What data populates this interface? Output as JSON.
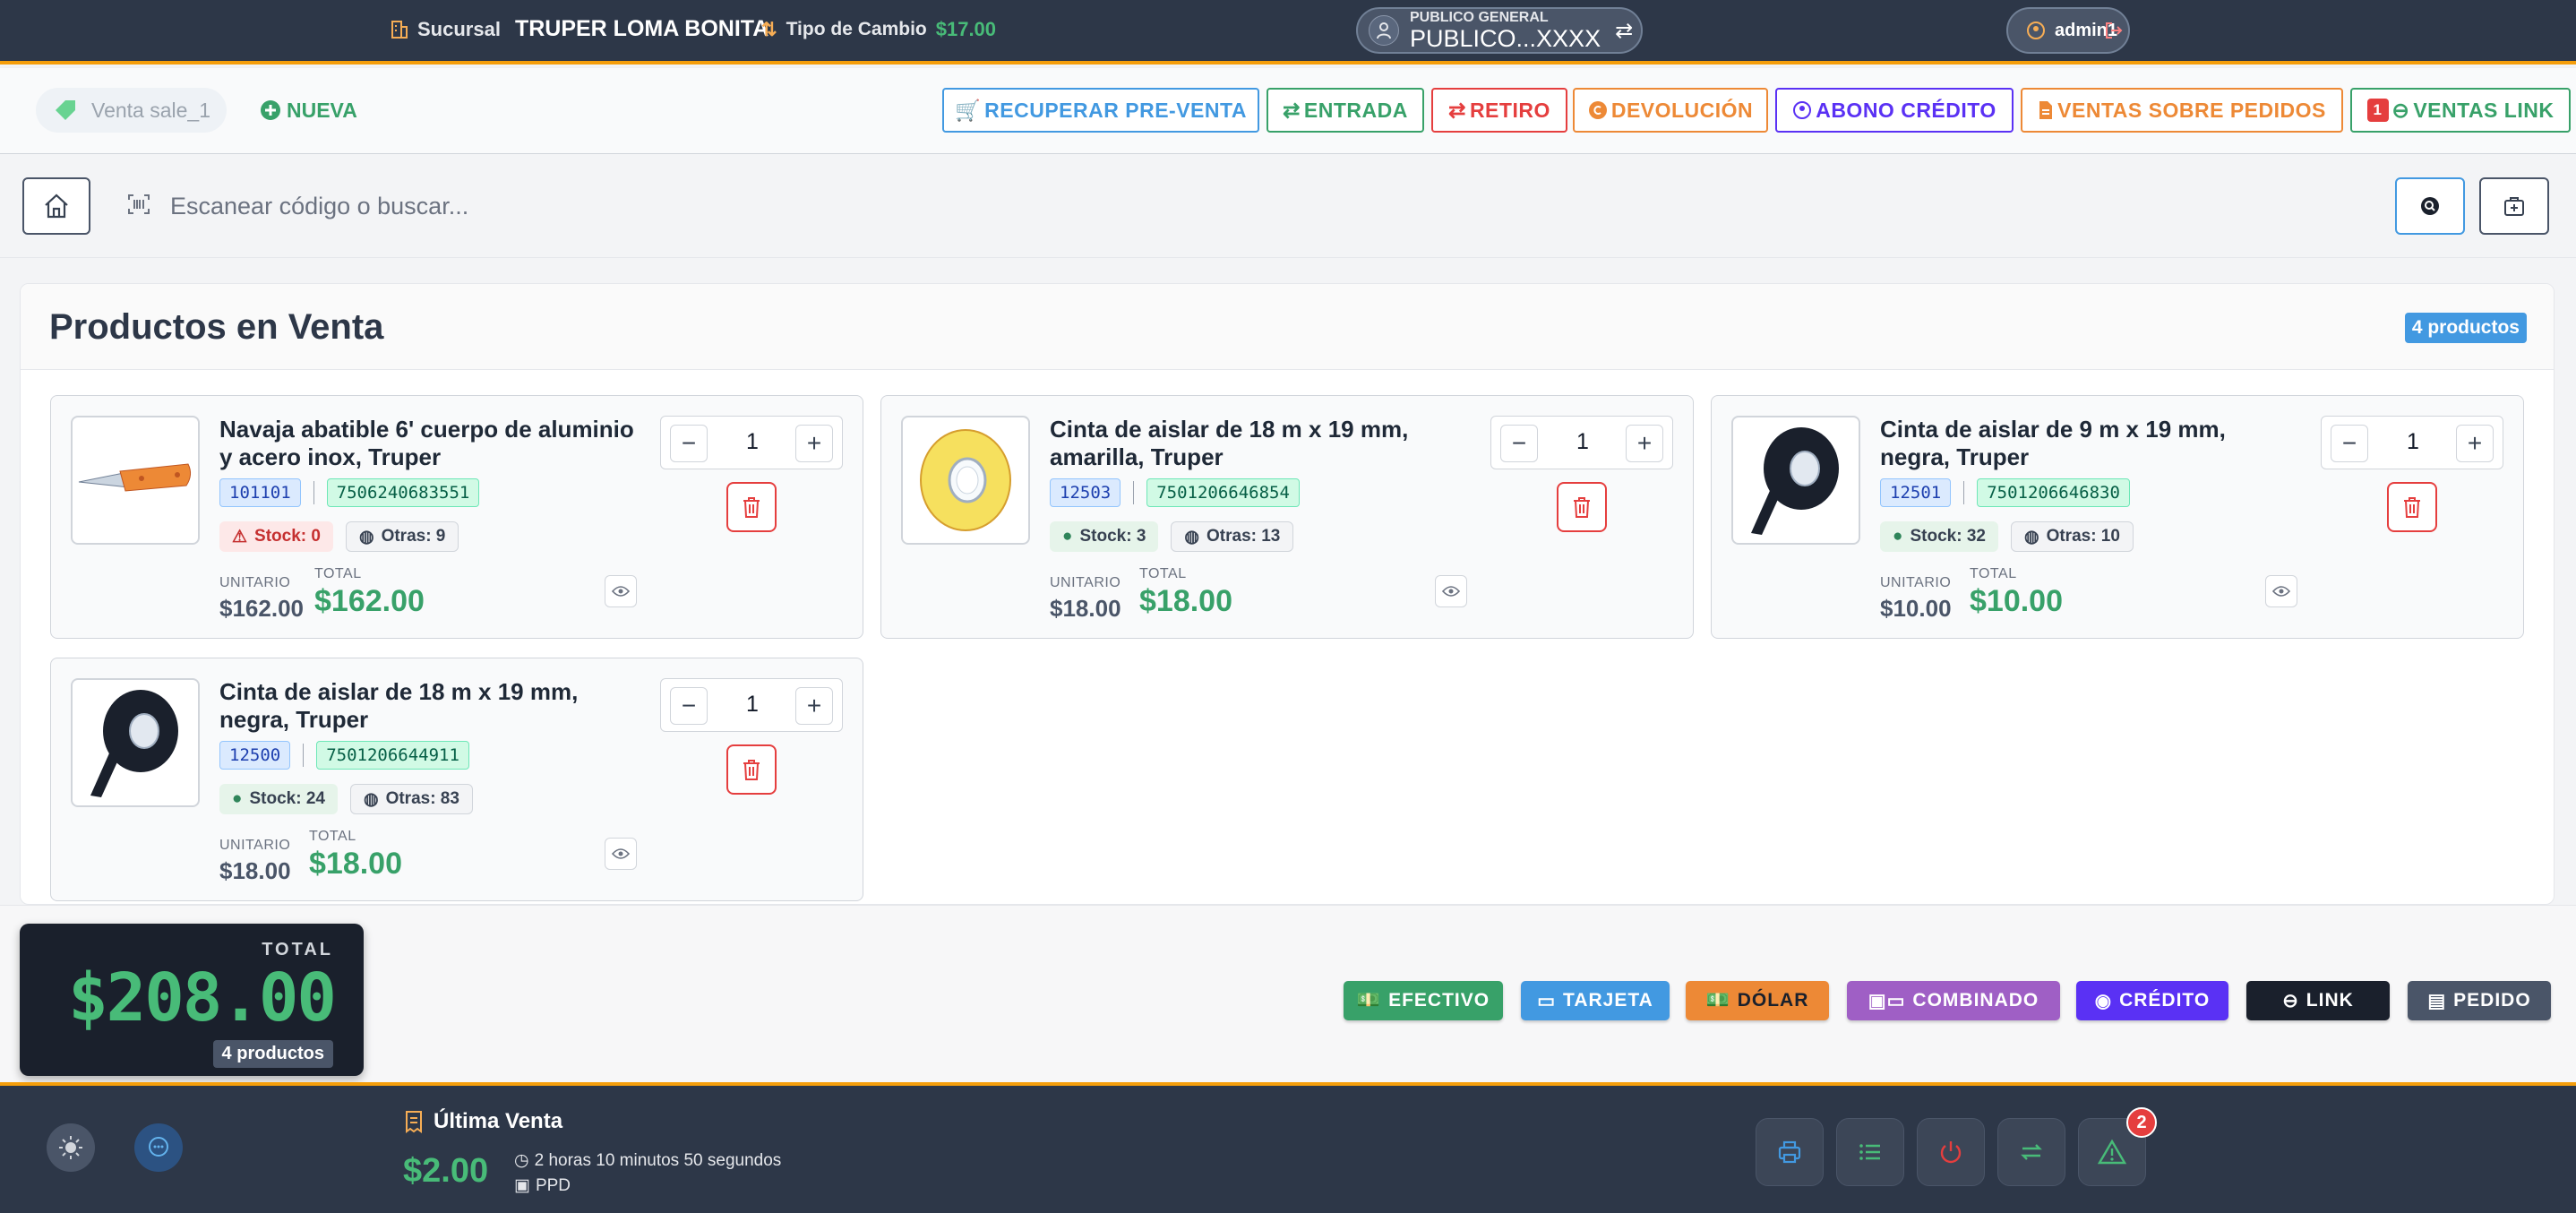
{
  "header": {
    "branch_label": "Sucursal",
    "branch_name": "TRUPER LOMA BONITA",
    "rate_label": "Tipo de Cambio",
    "rate_value": "$17.00",
    "client_type": "PUBLICO GENERAL",
    "client_name": "PUBLICO...XXXX",
    "user": "admin1"
  },
  "toolbar": {
    "sale_tab": "Venta sale_1",
    "new_label": "NUEVA",
    "actions": [
      {
        "label": "RECUPERAR PRE-VENTA",
        "color": "#4299e1"
      },
      {
        "label": "ENTRADA",
        "color": "#38a169"
      },
      {
        "label": "RETIRO",
        "color": "#e53e3e"
      },
      {
        "label": "DEVOLUCIÓN",
        "color": "#ed8936"
      },
      {
        "label": "ABONO CRÉDITO",
        "color": "#5a31f4"
      },
      {
        "label": "VENTAS SOBRE PEDIDOS",
        "color": "#ed8936"
      },
      {
        "label": "VENTAS LINK",
        "color": "#38a169",
        "badge": "1"
      }
    ]
  },
  "search": {
    "placeholder": "Escanear código o buscar..."
  },
  "products_panel": {
    "title": "Productos en Venta",
    "count_badge": "4 productos",
    "unit_label": "UNITARIO",
    "total_label": "TOTAL",
    "items": [
      {
        "name": "Navaja abatible 6' cuerpo de aluminio y acero inox, Truper",
        "sku": "101101",
        "barcode": "7506240683551",
        "stock": "Stock: 0",
        "stock_ok": false,
        "others": "Otras: 9",
        "unit": "$162.00",
        "total": "$162.00",
        "qty": "1",
        "thumb": "knife"
      },
      {
        "name": "Cinta de aislar de 18 m x 19 mm, amarilla, Truper",
        "sku": "12503",
        "barcode": "7501206646854",
        "stock": "Stock: 3",
        "stock_ok": true,
        "others": "Otras: 13",
        "unit": "$18.00",
        "total": "$18.00",
        "qty": "1",
        "thumb": "tape-yellow"
      },
      {
        "name": "Cinta de aislar de 9 m x 19 mm, negra, Truper",
        "sku": "12501",
        "barcode": "7501206646830",
        "stock": "Stock: 32",
        "stock_ok": true,
        "others": "Otras: 10",
        "unit": "$10.00",
        "total": "$10.00",
        "qty": "1",
        "thumb": "tape-black"
      },
      {
        "name": "Cinta de aislar de 18 m x 19 mm, negra, Truper",
        "sku": "12500",
        "barcode": "7501206644911",
        "stock": "Stock: 24",
        "stock_ok": true,
        "others": "Otras: 83",
        "unit": "$18.00",
        "total": "$18.00",
        "qty": "1",
        "thumb": "tape-black"
      }
    ]
  },
  "payment": {
    "total_label": "TOTAL",
    "total_value": "$208.00",
    "total_count": "4 productos",
    "methods": [
      {
        "label": "EFECTIVO",
        "color": "#38a169"
      },
      {
        "label": "TARJETA",
        "color": "#4299e1"
      },
      {
        "label": "DÓLAR",
        "color": "#ed8936"
      },
      {
        "label": "COMBINADO",
        "color": "#9f5fc5"
      },
      {
        "label": "CRÉDITO",
        "color": "#5a31f4"
      },
      {
        "label": "LINK",
        "color": "#1a202c"
      },
      {
        "label": "PEDIDO",
        "color": "#4a5568"
      }
    ]
  },
  "footer": {
    "last_sale_title": "Última Venta",
    "last_sale_amount": "$2.00",
    "last_sale_time": "2 horas 10 minutos 50 segundos",
    "last_sale_method": "PPD",
    "alerts_badge": "2"
  }
}
